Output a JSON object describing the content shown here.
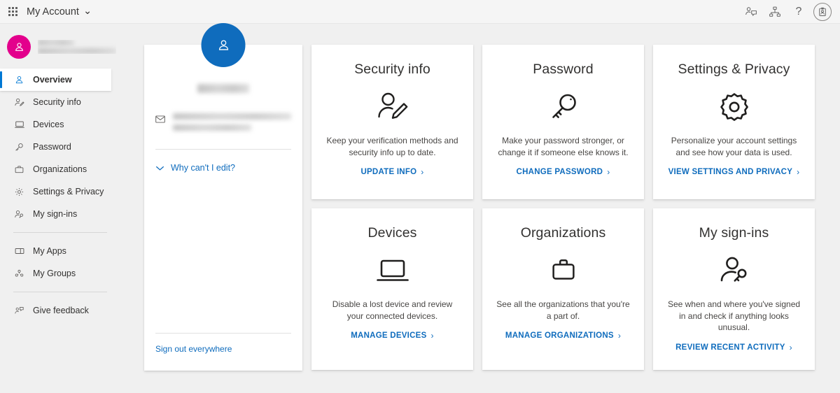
{
  "topbar": {
    "waffle_label": "app-launcher",
    "brand": "My Account",
    "brand_chevron": "⌄",
    "help_glyph": "?",
    "actions": [
      {
        "name": "feedback-icon",
        "label": "Give feedback"
      },
      {
        "name": "org-chart-icon",
        "label": "Organization"
      },
      {
        "name": "help-icon",
        "label": "Help"
      },
      {
        "name": "id-badge-icon",
        "label": "My Account"
      }
    ]
  },
  "sidebar": {
    "profile": {
      "name_redacted": "",
      "email_redacted": ""
    },
    "items": [
      {
        "label": "Overview",
        "icon": "person-icon",
        "selected": true
      },
      {
        "label": "Security info",
        "icon": "person-edit-icon",
        "selected": false
      },
      {
        "label": "Devices",
        "icon": "laptop-icon",
        "selected": false
      },
      {
        "label": "Password",
        "icon": "key-icon",
        "selected": false
      },
      {
        "label": "Organizations",
        "icon": "briefcase-icon",
        "selected": false
      },
      {
        "label": "Settings & Privacy",
        "icon": "gear-icon",
        "selected": false
      },
      {
        "label": "My sign-ins",
        "icon": "person-key-icon",
        "selected": false
      },
      {
        "label": "My Apps",
        "icon": "apps-icon",
        "selected": false
      },
      {
        "label": "My Groups",
        "icon": "groups-icon",
        "selected": false
      },
      {
        "label": "Give feedback",
        "icon": "feedback-icon",
        "selected": false
      }
    ]
  },
  "profile_card": {
    "avatar_icon": "person-icon",
    "name_redacted": "",
    "mail_icon": "mail-icon",
    "email_redacted": "",
    "why_edit_label": "Why can't I edit?",
    "why_edit_chevron": "⌄",
    "sign_out_label": "Sign out everywhere"
  },
  "tiles": [
    {
      "title": "Security info",
      "icon": "person-edit-icon",
      "desc": "Keep your verification methods and security info up to date.",
      "link": "UPDATE INFO",
      "chevron": "›"
    },
    {
      "title": "Password",
      "icon": "key-icon",
      "desc": "Make your password stronger, or change it if someone else knows it.",
      "link": "CHANGE PASSWORD",
      "chevron": "›"
    },
    {
      "title": "Settings & Privacy",
      "icon": "gear-icon",
      "desc": "Personalize your account settings and see how your data is used.",
      "link": "VIEW SETTINGS AND PRIVACY",
      "chevron": "›"
    },
    {
      "title": "Devices",
      "icon": "laptop-icon",
      "desc": "Disable a lost device and review your connected devices.",
      "link": "MANAGE DEVICES",
      "chevron": "›"
    },
    {
      "title": "Organizations",
      "icon": "briefcase-icon",
      "desc": "See all the organizations that you're a part of.",
      "link": "MANAGE ORGANIZATIONS",
      "chevron": "›"
    },
    {
      "title": "My sign-ins",
      "icon": "person-key-icon",
      "desc": "See when and where you've signed in and check if anything looks unusual.",
      "link": "REVIEW RECENT ACTIVITY",
      "chevron": "›"
    }
  ],
  "colors": {
    "accent_blue": "#0f6cbd",
    "selection_blue": "#0078d4",
    "avatar_blue": "#0f6cbd",
    "avatar_magenta": "#e3008c",
    "page_bg": "#f0f0f0",
    "card_bg": "#ffffff",
    "text_primary": "#323130",
    "text_secondary": "#484644"
  }
}
